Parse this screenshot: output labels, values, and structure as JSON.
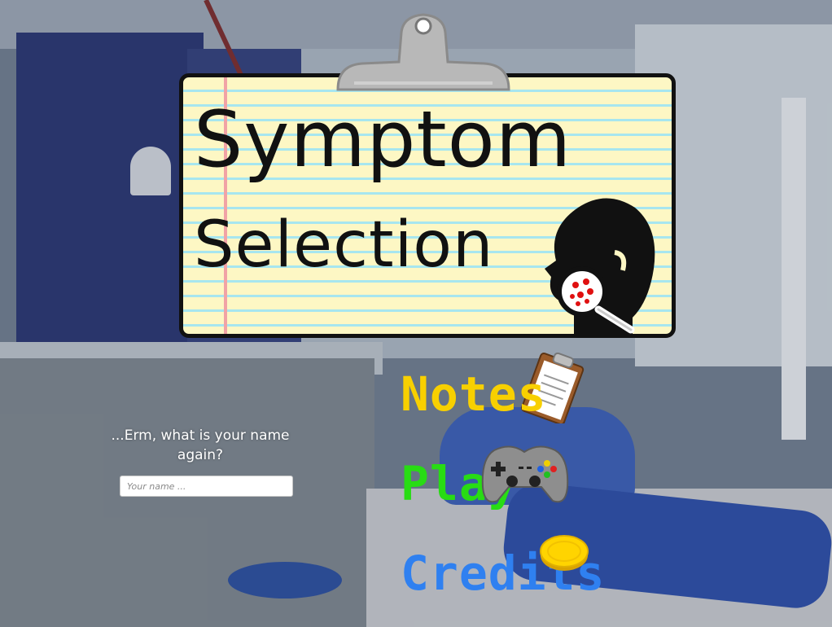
{
  "game": {
    "title_line1": "Symptom",
    "title_line2": "Selection"
  },
  "name_prompt": {
    "label": "...Erm, what is your name again?",
    "input_value": "",
    "placeholder": "Your name ..."
  },
  "menu": {
    "notes": {
      "label": "Notes",
      "icon": "clipboard-icon",
      "color": "#f8d000"
    },
    "play": {
      "label": "Play",
      "icon": "gamepad-icon",
      "color": "#28dc14"
    },
    "credits": {
      "label": "Credits",
      "icon": "coin-icon",
      "color": "#2f80f0"
    }
  },
  "title_icon": "face-magnifier-icon"
}
